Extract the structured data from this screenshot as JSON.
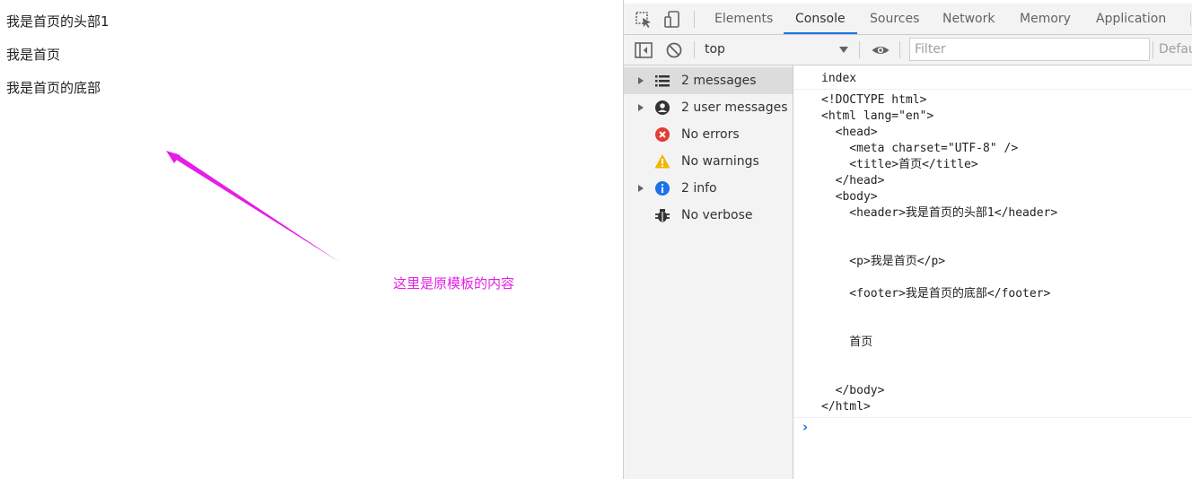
{
  "page": {
    "lines": [
      "我是首页的头部1",
      "我是首页",
      "我是首页的底部"
    ],
    "annotation": "这里是原模板的内容"
  },
  "colors": {
    "annotation": "#e61ee6",
    "devtools_bg": "#f3f3f3",
    "active_tab_underline": "#1a73e8",
    "error": "#e53935",
    "warning": "#f4b400",
    "info": "#1a73e8"
  },
  "devtools": {
    "tabs": [
      "Elements",
      "Console",
      "Sources",
      "Network",
      "Memory",
      "Application"
    ],
    "active_tab": "Console",
    "toolbar": {
      "context": "top",
      "filter_placeholder": "Filter",
      "levels_label": "Defau"
    },
    "sidebar": [
      {
        "label": "2 messages",
        "icon": "list-icon",
        "expandable": true
      },
      {
        "label": "2 user messages",
        "icon": "user-icon",
        "expandable": true
      },
      {
        "label": "No errors",
        "icon": "error-icon",
        "expandable": false
      },
      {
        "label": "No warnings",
        "icon": "warning-icon",
        "expandable": false
      },
      {
        "label": "2 info",
        "icon": "info-icon",
        "expandable": true
      },
      {
        "label": "No verbose",
        "icon": "bug-icon",
        "expandable": false
      }
    ],
    "console": {
      "first_message": "index",
      "html_lines": [
        "<!DOCTYPE html>",
        "<html lang=\"en\">",
        "  <head>",
        "    <meta charset=\"UTF-8\" />",
        "    <title>首页</title>",
        "  </head>",
        "  <body>",
        "    <header>我是首页的头部1</header>",
        "",
        "",
        "    <p>我是首页</p>",
        "",
        "    <footer>我是首页的底部</footer>",
        "",
        "",
        "    首页",
        "",
        "",
        "  </body>",
        "</html>"
      ],
      "prompt": "›"
    }
  }
}
